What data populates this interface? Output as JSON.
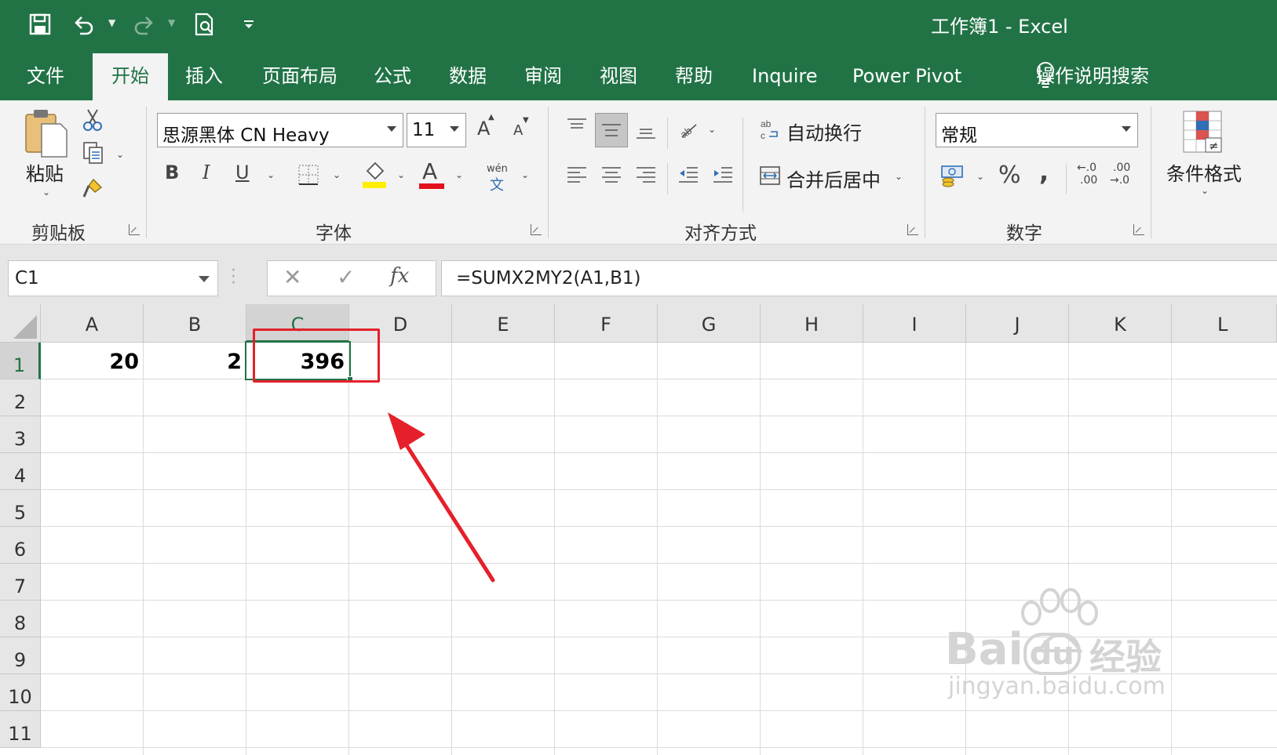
{
  "window": {
    "title": "工作簿1  -  Excel"
  },
  "qat": {
    "save": "save-icon",
    "undo": "undo-icon",
    "redo": "redo-icon",
    "print_preview": "print-preview-icon",
    "customize": "customize-qat-icon"
  },
  "tabs": [
    "文件",
    "开始",
    "插入",
    "页面布局",
    "公式",
    "数据",
    "审阅",
    "视图",
    "帮助",
    "Inquire",
    "Power Pivot",
    "操作说明搜索"
  ],
  "active_tab": "开始",
  "ribbon": {
    "clipboard": {
      "paste_label": "粘贴",
      "group_label": "剪贴板"
    },
    "font": {
      "name": "思源黑体 CN Heavy",
      "size": "11",
      "bold": "B",
      "italic": "I",
      "underline": "U",
      "phonetic_top": "wén",
      "phonetic_bottom": "文",
      "grow": "A",
      "shrink": "A",
      "font_color_glyph": "A",
      "group_label": "字体",
      "highlight_color": "#ffee00",
      "font_color": "#e3101c"
    },
    "alignment": {
      "wrap_text": "自动换行",
      "merge_center": "合并后居中",
      "group_label": "对齐方式"
    },
    "number": {
      "format": "常规",
      "percent": "%",
      "comma": ",",
      "inc_decimal_top": "←.0",
      "inc_decimal_bottom": ".00",
      "dec_decimal_top": ".00",
      "dec_decimal_bottom": "→.0",
      "group_label": "数字"
    },
    "styles": {
      "conditional_format": "条件格式"
    }
  },
  "formula_bar": {
    "name_box": "C1",
    "fx": "fx",
    "formula": "=SUMX2MY2(A1,B1)"
  },
  "grid": {
    "columns": [
      "A",
      "B",
      "C",
      "D",
      "E",
      "F",
      "G",
      "H",
      "I",
      "J",
      "K",
      "L"
    ],
    "rows": [
      "1",
      "2",
      "3",
      "4",
      "5",
      "6",
      "7",
      "8",
      "9",
      "10",
      "11"
    ],
    "selected_cell": "C1",
    "cells": {
      "A1": "20",
      "B1": "2",
      "C1": "396"
    }
  },
  "watermark": {
    "brand": "Bai",
    "brand_tail": "du",
    "cn": "经验",
    "url": "jingyan.baidu.com"
  },
  "colors": {
    "excel_green": "#217346",
    "annotation_red": "#e5202a"
  }
}
